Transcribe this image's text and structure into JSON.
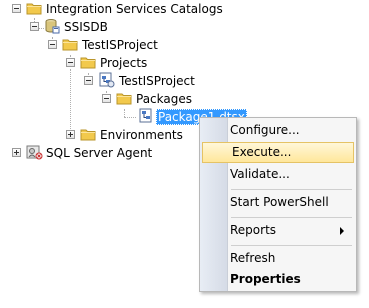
{
  "tree": {
    "catalogs": {
      "label": "Integration Services Catalogs",
      "icon": "folder-icon"
    },
    "ssisdb": {
      "label": "SSISDB",
      "icon": "database-icon"
    },
    "project_folder": {
      "label": "TestISProject",
      "icon": "folder-icon"
    },
    "projects": {
      "label": "Projects",
      "icon": "folder-icon"
    },
    "project": {
      "label": "TestISProject",
      "icon": "project-icon"
    },
    "packages": {
      "label": "Packages",
      "icon": "folder-icon"
    },
    "package": {
      "label": "Package1.dtsx",
      "icon": "package-icon"
    },
    "environments": {
      "label": "Environments",
      "icon": "folder-icon"
    },
    "sql_agent": {
      "label": "SQL Server Agent",
      "icon": "sql-agent-icon"
    }
  },
  "context_menu": {
    "configure": "Configure...",
    "execute": "Execute...",
    "validate": "Validate...",
    "start_powershell": "Start PowerShell",
    "reports": "Reports",
    "refresh": "Refresh",
    "properties": "Properties"
  },
  "colors": {
    "selection": "#3399ff",
    "folder": "#f2c94c",
    "menu_hover": "#ffe79b"
  }
}
